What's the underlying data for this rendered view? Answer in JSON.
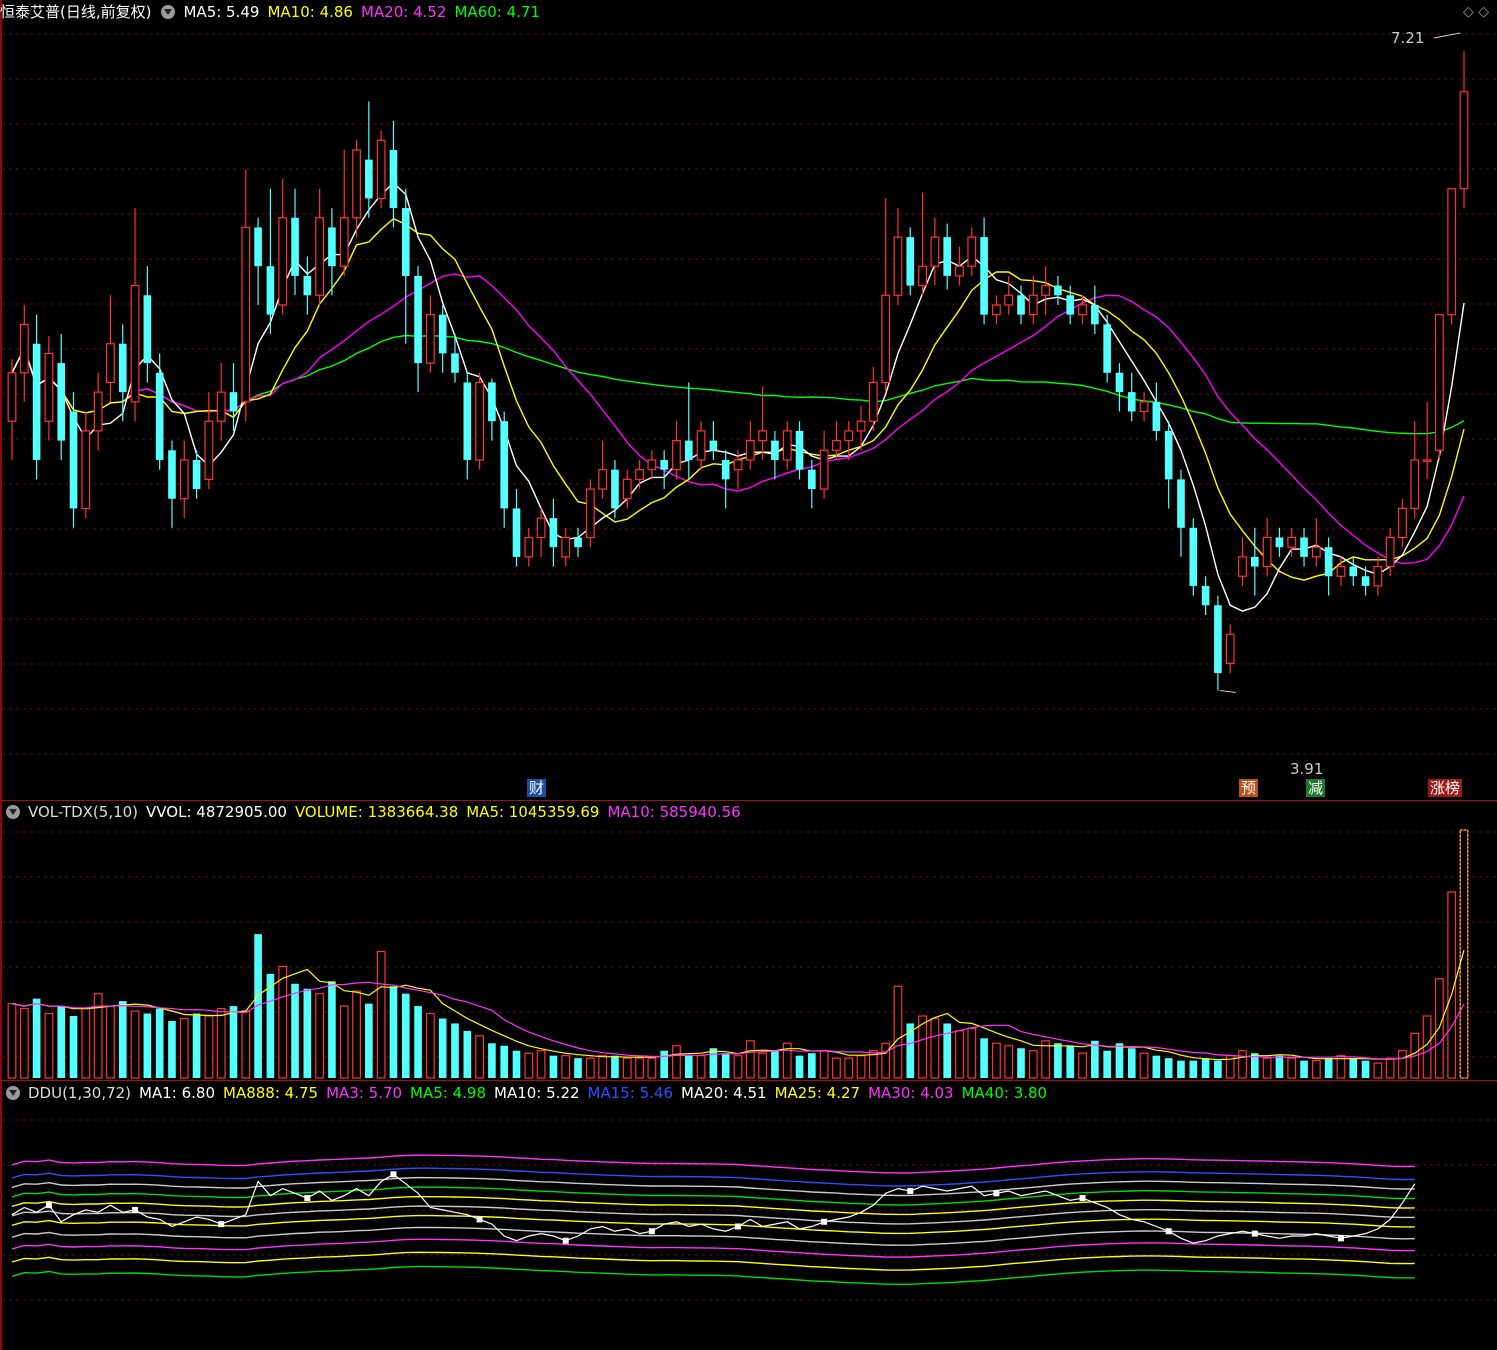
{
  "main_panel": {
    "title": "恒泰艾普(日线,前复权)",
    "indicators": [
      {
        "label": "MA5: 5.49",
        "color": "#ffffff"
      },
      {
        "label": "MA10: 4.86",
        "color": "#ffff00"
      },
      {
        "label": "MA20: 4.52",
        "color": "#ff00ff"
      },
      {
        "label": "MA60: 4.71",
        "color": "#00ff00"
      }
    ],
    "high_label": "7.21",
    "low_label": "3.91",
    "badges": [
      {
        "text": "财",
        "bg": "#1e4fa0"
      },
      {
        "text": "预",
        "bg": "#c0501a"
      },
      {
        "text": "减",
        "bg": "#1e7a2a"
      },
      {
        "text": "涨榜",
        "bg": "#a01818"
      }
    ]
  },
  "volume_panel": {
    "title": "VOL-TDX(5,10)",
    "indicators": [
      {
        "label": "VVOL: 4872905.00",
        "color": "#ffffff"
      },
      {
        "label": "VOLUME: 1383664.38",
        "color": "#ffff00"
      },
      {
        "label": "MA5: 1045359.69",
        "color": "#ffff00"
      },
      {
        "label": "MA10: 585940.56",
        "color": "#ff00ff"
      }
    ]
  },
  "ddu_panel": {
    "title": "DDU(1,30,72)",
    "indicators": [
      {
        "label": "MA1: 6.80",
        "color": "#ffffff"
      },
      {
        "label": "MA888: 4.75",
        "color": "#ffff00"
      },
      {
        "label": "MA3: 5.70",
        "color": "#ff00ff"
      },
      {
        "label": "MA5: 4.98",
        "color": "#00ff00"
      },
      {
        "label": "MA10: 5.22",
        "color": "#ffffff"
      },
      {
        "label": "MA15: 5.46",
        "color": "#2020ff"
      },
      {
        "label": "MA20: 4.51",
        "color": "#ffffff"
      },
      {
        "label": "MA25: 4.27",
        "color": "#ffff00"
      },
      {
        "label": "MA30: 4.03",
        "color": "#ff00ff"
      },
      {
        "label": "MA40: 3.80",
        "color": "#00ff00"
      }
    ]
  },
  "chart_data": {
    "type": "candlestick",
    "price_range": [
      3.5,
      7.35
    ],
    "candles": [
      [
        5.3,
        5.55,
        5.1,
        5.62
      ],
      [
        5.55,
        5.8,
        5.4,
        5.9
      ],
      [
        5.7,
        5.1,
        5.0,
        5.85
      ],
      [
        5.3,
        5.65,
        5.2,
        5.74
      ],
      [
        5.6,
        5.2,
        5.1,
        5.75
      ],
      [
        5.35,
        4.85,
        4.75,
        5.45
      ],
      [
        4.85,
        5.25,
        4.8,
        5.35
      ],
      [
        5.25,
        5.45,
        5.15,
        5.55
      ],
      [
        5.5,
        5.7,
        5.4,
        5.95
      ],
      [
        5.7,
        5.45,
        5.3,
        5.8
      ],
      [
        5.4,
        6.0,
        5.3,
        6.4
      ],
      [
        5.95,
        5.6,
        5.5,
        6.1
      ],
      [
        5.55,
        5.1,
        5.05,
        5.65
      ],
      [
        5.15,
        4.9,
        4.75,
        5.2
      ],
      [
        4.9,
        5.1,
        4.8,
        5.2
      ],
      [
        5.1,
        4.95,
        4.9,
        5.15
      ],
      [
        5.0,
        5.3,
        4.95,
        5.45
      ],
      [
        5.3,
        5.45,
        5.2,
        5.6
      ],
      [
        5.45,
        5.35,
        5.25,
        5.6
      ],
      [
        5.4,
        6.3,
        5.3,
        6.6
      ],
      [
        6.3,
        6.1,
        5.9,
        6.35
      ],
      [
        6.1,
        5.85,
        5.75,
        6.5
      ],
      [
        5.9,
        6.35,
        5.85,
        6.55
      ],
      [
        6.35,
        6.05,
        5.95,
        6.5
      ],
      [
        6.05,
        5.95,
        5.85,
        6.15
      ],
      [
        5.95,
        6.35,
        5.9,
        6.5
      ],
      [
        6.3,
        6.1,
        5.95,
        6.4
      ],
      [
        6.1,
        6.35,
        6.05,
        6.7
      ],
      [
        6.35,
        6.7,
        6.25,
        6.75
      ],
      [
        6.65,
        6.45,
        6.35,
        6.95
      ],
      [
        6.45,
        6.75,
        6.4,
        6.8
      ],
      [
        6.7,
        6.4,
        6.3,
        6.85
      ],
      [
        6.4,
        6.05,
        5.7,
        6.5
      ],
      [
        6.05,
        5.6,
        5.45,
        6.1
      ],
      [
        5.6,
        5.85,
        5.55,
        5.95
      ],
      [
        5.85,
        5.65,
        5.55,
        5.9
      ],
      [
        5.65,
        5.55,
        5.5,
        5.75
      ],
      [
        5.5,
        5.1,
        5.0,
        5.55
      ],
      [
        5.1,
        5.5,
        5.05,
        5.55
      ],
      [
        5.5,
        5.3,
        5.2,
        5.52
      ],
      [
        5.3,
        4.85,
        4.75,
        5.35
      ],
      [
        4.85,
        4.6,
        4.55,
        4.95
      ],
      [
        4.6,
        4.7,
        4.55,
        4.75
      ],
      [
        4.7,
        4.8,
        4.6,
        4.85
      ],
      [
        4.8,
        4.65,
        4.55,
        4.9
      ],
      [
        4.6,
        4.7,
        4.55,
        4.75
      ],
      [
        4.7,
        4.65,
        4.6,
        4.75
      ],
      [
        4.7,
        4.95,
        4.65,
        5.0
      ],
      [
        4.95,
        5.05,
        4.9,
        5.2
      ],
      [
        5.05,
        4.85,
        4.8,
        5.1
      ],
      [
        4.9,
        5.0,
        4.85,
        5.05
      ],
      [
        5.0,
        5.05,
        4.95,
        5.1
      ],
      [
        5.05,
        5.1,
        5.0,
        5.15
      ],
      [
        5.1,
        5.05,
        4.95,
        5.15
      ],
      [
        5.05,
        5.2,
        5.0,
        5.3
      ],
      [
        5.2,
        5.1,
        5.0,
        5.5
      ],
      [
        5.1,
        5.25,
        5.05,
        5.3
      ],
      [
        5.2,
        5.15,
        5.1,
        5.3
      ],
      [
        5.1,
        5.0,
        4.85,
        5.15
      ],
      [
        5.05,
        5.1,
        4.95,
        5.15
      ],
      [
        5.1,
        5.2,
        5.05,
        5.3
      ],
      [
        5.2,
        5.25,
        5.1,
        5.48
      ],
      [
        5.2,
        5.1,
        5.0,
        5.25
      ],
      [
        5.1,
        5.25,
        5.05,
        5.3
      ],
      [
        5.25,
        5.05,
        5.0,
        5.3
      ],
      [
        5.05,
        4.95,
        4.85,
        5.1
      ],
      [
        4.95,
        5.15,
        4.9,
        5.25
      ],
      [
        5.15,
        5.2,
        5.1,
        5.3
      ],
      [
        5.2,
        5.25,
        5.1,
        5.3
      ],
      [
        5.25,
        5.3,
        5.15,
        5.38
      ],
      [
        5.3,
        5.5,
        5.25,
        5.58
      ],
      [
        5.5,
        5.95,
        5.45,
        6.45
      ],
      [
        5.95,
        6.25,
        5.9,
        6.4
      ],
      [
        6.25,
        6.0,
        5.95,
        6.3
      ],
      [
        6.0,
        6.1,
        5.95,
        6.48
      ],
      [
        6.1,
        6.25,
        6.0,
        6.35
      ],
      [
        6.25,
        6.05,
        5.98,
        6.32
      ],
      [
        6.05,
        6.1,
        6.0,
        6.2
      ],
      [
        6.1,
        6.25,
        6.05,
        6.3
      ],
      [
        6.25,
        5.85,
        5.8,
        6.35
      ],
      [
        5.85,
        5.9,
        5.8,
        5.95
      ],
      [
        5.9,
        5.95,
        5.85,
        6.05
      ],
      [
        5.95,
        5.85,
        5.8,
        6.0
      ],
      [
        5.85,
        5.95,
        5.8,
        6.05
      ],
      [
        5.95,
        6.0,
        5.85,
        6.1
      ],
      [
        6.0,
        5.95,
        5.9,
        6.05
      ],
      [
        5.95,
        5.85,
        5.8,
        6.0
      ],
      [
        5.85,
        5.9,
        5.8,
        5.95
      ],
      [
        5.9,
        5.8,
        5.75,
        6.0
      ],
      [
        5.8,
        5.55,
        5.5,
        5.85
      ],
      [
        5.55,
        5.45,
        5.35,
        5.6
      ],
      [
        5.45,
        5.35,
        5.3,
        5.55
      ],
      [
        5.35,
        5.4,
        5.3,
        5.45
      ],
      [
        5.4,
        5.25,
        5.2,
        5.5
      ],
      [
        5.25,
        5.0,
        4.85,
        5.3
      ],
      [
        5.0,
        4.75,
        4.6,
        5.05
      ],
      [
        4.75,
        4.45,
        4.4,
        4.8
      ],
      [
        4.45,
        4.35,
        4.3,
        4.5
      ],
      [
        4.35,
        4.0,
        3.91,
        4.4
      ],
      [
        4.05,
        4.2,
        4.0,
        4.25
      ],
      [
        4.5,
        4.6,
        4.45,
        4.7
      ],
      [
        4.6,
        4.55,
        4.4,
        4.75
      ],
      [
        4.55,
        4.7,
        4.5,
        4.8
      ],
      [
        4.7,
        4.65,
        4.6,
        4.75
      ],
      [
        4.65,
        4.7,
        4.6,
        4.75
      ],
      [
        4.7,
        4.6,
        4.55,
        4.75
      ],
      [
        4.6,
        4.65,
        4.55,
        4.8
      ],
      [
        4.65,
        4.5,
        4.4,
        4.7
      ],
      [
        4.5,
        4.55,
        4.45,
        4.6
      ],
      [
        4.55,
        4.5,
        4.45,
        4.6
      ],
      [
        4.5,
        4.45,
        4.4,
        4.55
      ],
      [
        4.45,
        4.55,
        4.4,
        4.6
      ],
      [
        4.55,
        4.7,
        4.5,
        4.75
      ],
      [
        4.7,
        4.85,
        4.65,
        4.9
      ],
      [
        4.85,
        5.1,
        4.8,
        5.3
      ],
      [
        5.1,
        5.1,
        5.0,
        5.4
      ],
      [
        5.15,
        5.85,
        5.1,
        5.85
      ],
      [
        5.85,
        6.5,
        5.8,
        6.5
      ],
      [
        6.5,
        7.0,
        6.4,
        7.21
      ]
    ],
    "ma_series_colors": [
      "#ffffff",
      "#ffff00",
      "#ff00ff",
      "#00ff00"
    ],
    "volume": [
      3.0,
      2.8,
      3.2,
      2.6,
      2.9,
      2.5,
      2.8,
      3.4,
      2.9,
      3.1,
      2.7,
      2.6,
      2.8,
      2.3,
      2.4,
      2.6,
      2.5,
      2.8,
      2.9,
      2.7,
      5.8,
      4.2,
      4.5,
      3.8,
      3.6,
      3.4,
      3.9,
      2.9,
      3.5,
      3.0,
      5.1,
      3.7,
      3.4,
      2.9,
      2.6,
      2.4,
      2.2,
      1.9,
      1.7,
      1.4,
      1.3,
      1.1,
      1.0,
      1.1,
      0.9,
      0.9,
      0.8,
      0.8,
      0.9,
      0.9,
      0.8,
      0.8,
      0.8,
      1.1,
      1.3,
      0.9,
      0.9,
      1.2,
      1.0,
      0.9,
      1.5,
      1.0,
      1.1,
      1.4,
      0.9,
      1.0,
      1.1,
      0.8,
      0.8,
      0.9,
      1.1,
      1.4,
      3.7,
      2.2,
      2.5,
      2.4,
      2.2,
      1.9,
      2.0,
      1.6,
      1.4,
      1.3,
      1.2,
      1.1,
      1.5,
      1.4,
      1.3,
      1.0,
      1.5,
      1.1,
      1.4,
      1.2,
      1.0,
      0.9,
      0.8,
      0.7,
      0.7,
      0.8,
      0.7,
      0.9,
      1.1,
      1.0,
      0.8,
      0.9,
      0.8,
      0.7,
      0.7,
      0.8,
      0.9,
      0.8,
      0.7,
      0.6,
      0.8,
      1.1,
      1.8,
      2.5,
      4.0,
      7.5,
      10.0
    ],
    "ddu_range": [
      0,
      10
    ],
    "ddu_values": [
      5.5,
      5.8,
      5.6,
      5.9,
      5.2,
      5.5,
      5.7,
      5.6,
      5.9,
      5.6,
      5.7,
      5.4,
      5.3,
      5.0,
      5.2,
      5.4,
      5.3,
      5.1,
      5.3,
      5.5,
      6.9,
      6.3,
      6.6,
      6.4,
      6.2,
      6.5,
      6.1,
      6.3,
      6.6,
      6.3,
      6.9,
      7.2,
      6.8,
      6.4,
      5.8,
      5.7,
      5.6,
      5.5,
      5.3,
      5.1,
      4.6,
      4.4,
      4.6,
      4.7,
      4.6,
      4.4,
      4.6,
      4.9,
      5.0,
      4.8,
      4.9,
      4.7,
      4.8,
      5.1,
      5.2,
      5.0,
      5.1,
      4.9,
      4.8,
      5.0,
      5.3,
      5.0,
      5.1,
      5.2,
      4.9,
      5.0,
      5.2,
      5.3,
      5.4,
      5.6,
      5.9,
      6.4,
      6.6,
      6.5,
      6.7,
      6.6,
      6.5,
      6.6,
      6.7,
      6.3,
      6.4,
      6.5,
      6.3,
      6.4,
      6.5,
      6.3,
      6.1,
      6.2,
      6.0,
      5.8,
      5.5,
      5.3,
      5.2,
      5.0,
      4.8,
      4.5,
      4.3,
      4.4,
      4.6,
      4.7,
      4.8,
      4.7,
      4.6,
      4.5,
      4.6,
      4.6,
      4.7,
      4.6,
      4.5,
      4.6,
      4.7,
      4.9,
      5.3,
      6.0,
      6.8
    ]
  }
}
